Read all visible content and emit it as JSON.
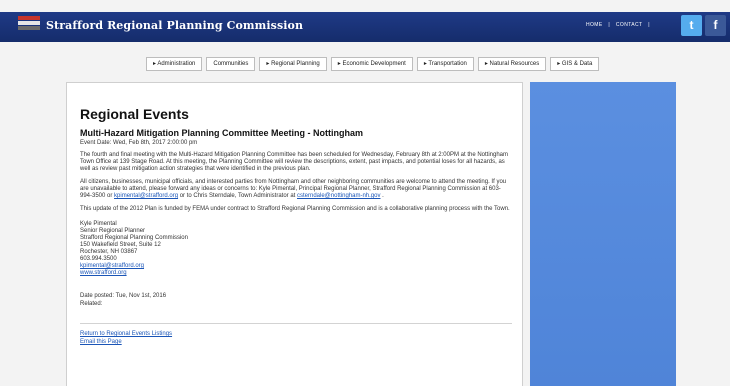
{
  "header": {
    "site_title": "Strafford Regional Planning Commission",
    "top_links": [
      "HOME",
      "|",
      "CONTACT",
      "|"
    ],
    "social": {
      "twitter_label": "t",
      "facebook_label": "f"
    }
  },
  "tabs": [
    "▸ Administration",
    "Communities",
    "▸ Regional Planning",
    "▸ Economic Development",
    "▸ Transportation",
    "▸ Natural Resources",
    "▸ GIS & Data"
  ],
  "page": {
    "title": "Regional Events",
    "event_title": "Multi-Hazard Mitigation Planning Committee Meeting - Nottingham",
    "event_date": "Event Date: Wed, Feb 8th, 2017 2:00:00 pm",
    "paragraph1": "The fourth and final meeting with the Multi-Hazard Mitigation Planning Committee has been scheduled for Wednesday, February 8th at 2:00PM at the Nottingham Town Office at 139 Stage Road. At this meeting, the Planning Committee will review the descriptions, extent, past impacts, and potential loses for all hazards, as well as review past mitigation action strategies that were identified in the previous plan.",
    "paragraph2_part1": "All citizens, businesses, municipal officials, and interested parties from Nottingham and other neighboring communities are welcome to attend the meeting. If you are unavailable to attend, please forward any ideas or concerns to: Kyle Pimental, Principal Regional Planner, Strafford Regional Planning Commission at 603-994-3500 or ",
    "paragraph2_link1": "kpimental@strafford.org",
    "paragraph2_part2": " or to Chris Sterndale, Town Administrator at ",
    "paragraph2_link2": "csterndale@nottingham-nh.gov",
    "paragraph2_part3": ".",
    "paragraph3": "This update of the 2012 Plan is funded by FEMA under contract to Strafford Regional Planning Commission and is a collaborative planning process with the Town.",
    "signature": [
      "Kyle Pimental",
      "Senior Regional Planner",
      "Strafford Regional Planning Commission",
      "150 Wakefield Street, Suite 12",
      "Rochester, NH 03867",
      "603.994.3500"
    ],
    "signature_email": "kpimental@strafford.org",
    "signature_web": "www.strafford.org",
    "date_posted": "Date posted: Tue, Nov 1st, 2016",
    "related": "Related:",
    "return_link": "Return to Regional Events Listings",
    "email_link": "Email this Page"
  },
  "colors": {
    "header": "#1b347a",
    "sidebar": "#5b8fe0",
    "link": "#1a55b7"
  }
}
